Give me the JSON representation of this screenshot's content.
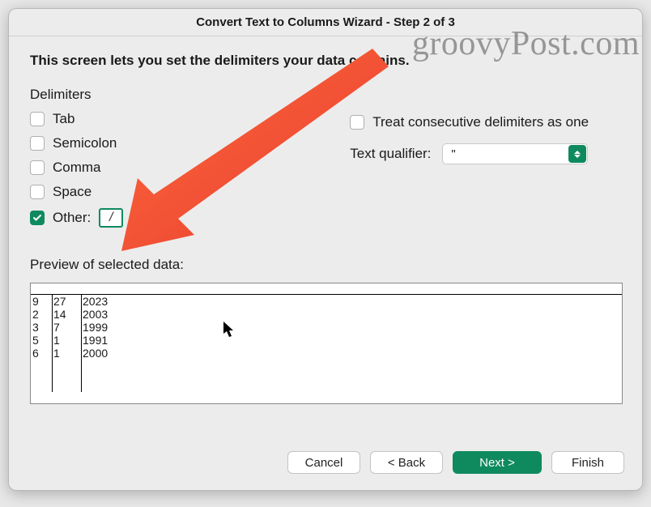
{
  "title": "Convert Text to Columns Wizard - Step 2 of 3",
  "instruction": "This screen lets you set the delimiters your data contains.",
  "delimiters": {
    "section_label": "Delimiters",
    "tab": "Tab",
    "semicolon": "Semicolon",
    "comma": "Comma",
    "space": "Space",
    "other": "Other:",
    "other_value": "/"
  },
  "options": {
    "treat_consecutive": "Treat consecutive delimiters as one",
    "text_qualifier_label": "Text qualifier:",
    "text_qualifier_value": "\""
  },
  "preview": {
    "label": "Preview of selected data:",
    "rows": [
      [
        "9",
        "27",
        "2023"
      ],
      [
        "2",
        "14",
        "2003"
      ],
      [
        "3",
        "7",
        "1999"
      ],
      [
        "5",
        "1",
        "1991"
      ],
      [
        "6",
        "1",
        "2000"
      ]
    ]
  },
  "buttons": {
    "cancel": "Cancel",
    "back": "< Back",
    "next": "Next >",
    "finish": "Finish"
  },
  "watermark": "groovyPost.com"
}
